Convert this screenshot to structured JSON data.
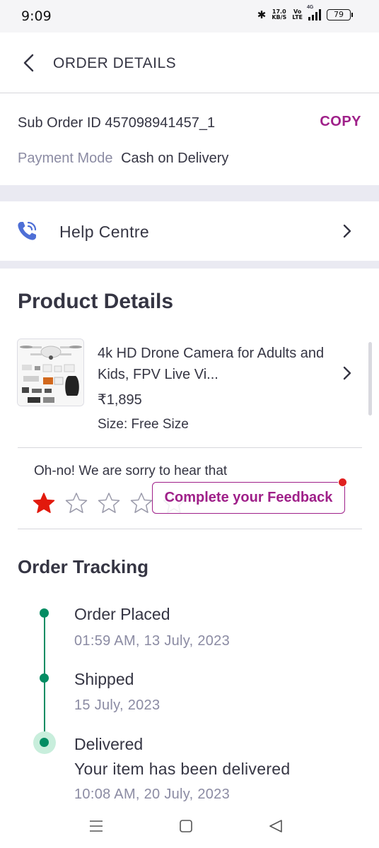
{
  "status_bar": {
    "time": "9:09",
    "speed_value": "17.0",
    "speed_unit": "KB/S",
    "volte_top": "Vo",
    "volte_bottom": "LTE",
    "network": "4G",
    "battery": "79"
  },
  "header": {
    "title": "ORDER DETAILS",
    "back_icon": "chevron-left-icon"
  },
  "order": {
    "sub_order_label": "Sub Order ID",
    "sub_order_id": "457098941457_1",
    "copy_label": "COPY",
    "payment_label": "Payment Mode",
    "payment_value": "Cash on Delivery"
  },
  "help": {
    "label": "Help Centre",
    "icon": "phone-icon"
  },
  "product": {
    "section_title": "Product Details",
    "name": "4k HD Drone Camera for Adults and Kids, FPV Live Vi...",
    "price": "₹1,895",
    "size": "Size: Free Size"
  },
  "feedback": {
    "message": "Oh-no! We are sorry to hear that",
    "rating": 1,
    "max_rating": 5,
    "button_label": "Complete your Feedback"
  },
  "tracking": {
    "title": "Order Tracking",
    "steps": [
      {
        "label": "Order Placed",
        "date": "01:59 AM, 13 July, 2023"
      },
      {
        "label": "Shipped",
        "date": "15 July, 2023"
      },
      {
        "label": "Delivered",
        "description": "Your item has been delivered",
        "date": "10:08 AM, 20 July, 2023"
      }
    ]
  },
  "colors": {
    "accent": "#9f2089",
    "text": "#353543",
    "muted": "#8b8ba3",
    "track_green": "#038d63",
    "star_red": "#e2190c"
  }
}
